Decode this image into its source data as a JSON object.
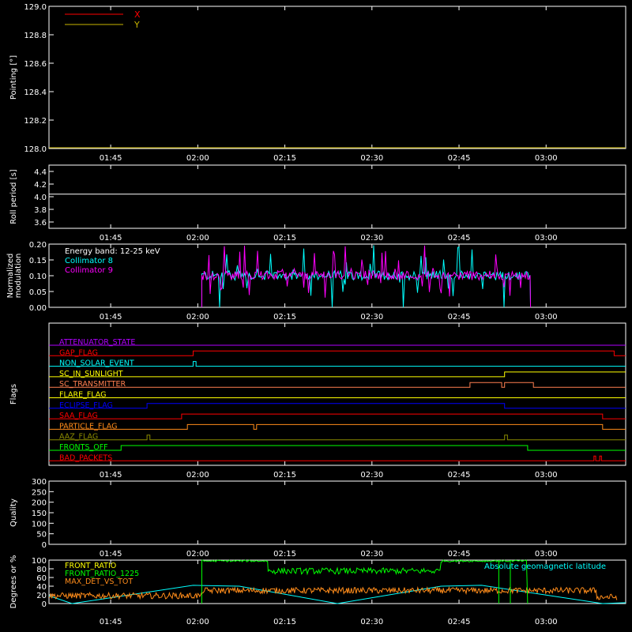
{
  "time_ticks": [
    "01:45",
    "02:00",
    "02:15",
    "02:30",
    "02:45",
    "03:00"
  ],
  "colors": {
    "axis": "#ffffff",
    "red": "#ff0000",
    "olive": "#c8b400",
    "cyan": "#00ffff",
    "magenta": "#ff00ff",
    "green": "#00ff00",
    "orange": "#ff8c1a",
    "blue": "#0000ff",
    "yellow": "#ffff00",
    "purple": "#b000ff",
    "salmon": "#ff7f50",
    "darkolive": "#8b8b00"
  },
  "chart_data": [
    {
      "id": "pointing",
      "type": "line",
      "ylabel": "Pointing [°]",
      "ylim": [
        128.0,
        129.0
      ],
      "yticks": [
        "128.0",
        "128.2",
        "128.4",
        "128.6",
        "128.8",
        "129.0"
      ],
      "legend": [
        {
          "name": "X",
          "color": "#ff0000"
        },
        {
          "name": "Y",
          "color": "#c8b400"
        }
      ],
      "series": [
        {
          "name": "X",
          "color": "#ff0000",
          "points": [
            [
              0,
              128.0
            ],
            [
              1,
              128.0
            ]
          ]
        },
        {
          "name": "Y",
          "color": "#c8b400",
          "points": [
            [
              0,
              128.0
            ],
            [
              1,
              128.0
            ]
          ]
        }
      ]
    },
    {
      "id": "roll",
      "type": "line",
      "ylabel": "Roll period [s]",
      "ylim": [
        3.5,
        4.5
      ],
      "yticks": [
        "3.6",
        "3.8",
        "4.0",
        "4.2",
        "4.4"
      ],
      "series": [
        {
          "name": "roll",
          "color": "#ffffff",
          "points": [
            [
              0,
              4.04
            ],
            [
              1,
              4.04
            ]
          ]
        }
      ]
    },
    {
      "id": "modulation",
      "type": "line",
      "ylabel": "Normalized modulation",
      "ylim": [
        0.0,
        0.2
      ],
      "yticks": [
        "0.00",
        "0.05",
        "0.10",
        "0.15",
        "0.20"
      ],
      "annotation": "Energy band: 12-25 keV",
      "legend": [
        {
          "name": "Collimator 8",
          "color": "#00ffff"
        },
        {
          "name": "Collimator 9",
          "color": "#ff00ff"
        }
      ],
      "active_range": [
        0.265,
        0.835
      ]
    },
    {
      "id": "flags",
      "type": "line",
      "ylabel": "Flags",
      "flags": [
        {
          "name": "ATTENUATOR_STATE",
          "color": "#b000ff",
          "toggles": []
        },
        {
          "name": "GAP_FLAG",
          "color": "#ff0000",
          "toggles": [
            0.25,
            0.98
          ]
        },
        {
          "name": "NON_SOLAR_EVENT",
          "color": "#00ffff",
          "toggles": [
            0.25,
            0.255
          ]
        },
        {
          "name": "SC_IN_SUNLIGHT",
          "color": "#ffff00",
          "toggles": [
            0.79
          ]
        },
        {
          "name": "SC_TRANSMITTER",
          "color": "#ff7f50",
          "toggles": [
            0.73,
            0.785,
            0.79,
            0.84
          ]
        },
        {
          "name": "FLARE_FLAG",
          "color": "#ffff00",
          "toggles": []
        },
        {
          "name": "ECLIPSE_FLAG",
          "color": "#0000ff",
          "toggles": [
            0.17,
            0.79
          ]
        },
        {
          "name": "SAA_FLAG",
          "color": "#ff0000",
          "toggles": [
            0.23,
            0.96
          ]
        },
        {
          "name": "PARTICLE_FLAG",
          "color": "#ff8c1a",
          "toggles": [
            0.24,
            0.355,
            0.36,
            0.96
          ]
        },
        {
          "name": "AAZ_FLAG",
          "color": "#8b8b00",
          "toggles": [
            0.17,
            0.175,
            0.79,
            0.795
          ]
        },
        {
          "name": "FRONTS_OFF",
          "color": "#00ff00",
          "toggles": [
            0.125,
            0.83
          ]
        },
        {
          "name": "BAD_PACKETS",
          "color": "#ff0000",
          "toggles": [
            0.945,
            0.948,
            0.955,
            0.958
          ]
        }
      ]
    },
    {
      "id": "quality",
      "type": "line",
      "ylabel": "Quality",
      "ylim": [
        0,
        300
      ],
      "yticks": [
        "0",
        "50",
        "100",
        "150",
        "200",
        "250",
        "300"
      ],
      "series": []
    },
    {
      "id": "front",
      "type": "line",
      "ylabel": "Degrees or %",
      "ylim": [
        0,
        100
      ],
      "yticks": [
        "0",
        "20",
        "40",
        "60",
        "80",
        "100"
      ],
      "legend": [
        {
          "name": "FRONT_RATIO",
          "color": "#ffff00"
        },
        {
          "name": "FRONT_RATIO_1225",
          "color": "#00ff00"
        },
        {
          "name": "MAX_DET_VS_TOT",
          "color": "#ff8c1a"
        }
      ],
      "right_label": {
        "text": "Absolute geomagnetic latitude",
        "color": "#00ffff"
      },
      "geomag_points": [
        [
          0,
          18
        ],
        [
          0.04,
          0
        ],
        [
          0.25,
          42
        ],
        [
          0.33,
          40
        ],
        [
          0.5,
          0
        ],
        [
          0.68,
          40
        ],
        [
          0.75,
          42
        ],
        [
          0.96,
          0
        ],
        [
          1,
          2
        ]
      ],
      "green_levels": [
        [
          0.265,
          0.38,
          98
        ],
        [
          0.38,
          0.68,
          75
        ],
        [
          0.68,
          0.83,
          98
        ]
      ],
      "orange_level": 30
    }
  ]
}
